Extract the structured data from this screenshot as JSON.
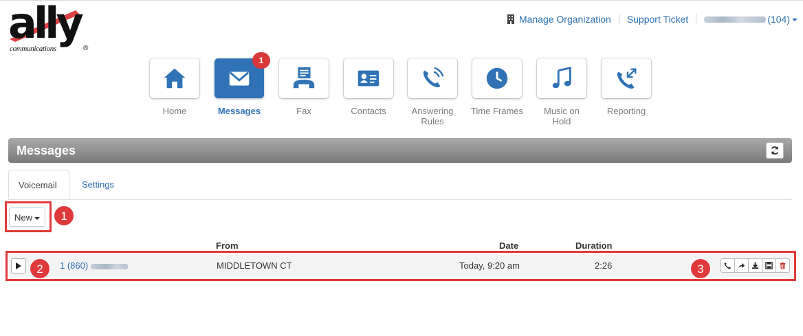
{
  "brand": {
    "logo_word": "ally",
    "logo_sub": "communications",
    "logo_reg": "®",
    "accent": "#e0393b",
    "blue": "#2f73b6"
  },
  "topnav": {
    "manage_org": "Manage Organization",
    "support": "Support Ticket",
    "user_ext": "(104)"
  },
  "apps": [
    {
      "label": "Home",
      "icon": "home-icon"
    },
    {
      "label": "Messages",
      "icon": "envelope-icon",
      "badge": "1",
      "active": true
    },
    {
      "label": "Fax",
      "icon": "fax-icon"
    },
    {
      "label": "Contacts",
      "icon": "contact-card-icon"
    },
    {
      "label": "Answering Rules",
      "icon": "phone-waves-icon"
    },
    {
      "label": "Time Frames",
      "icon": "clock-icon"
    },
    {
      "label": "Music on Hold",
      "icon": "music-note-icon"
    },
    {
      "label": "Reporting",
      "icon": "phone-arrows-icon"
    }
  ],
  "section": {
    "title": "Messages"
  },
  "tabs": {
    "voicemail": "Voicemail",
    "settings": "Settings"
  },
  "filter": {
    "label": "New"
  },
  "callouts": [
    "1",
    "2",
    "3"
  ],
  "table": {
    "headers": {
      "from": "From",
      "date": "Date",
      "duration": "Duration"
    },
    "rows": [
      {
        "phone": "1 (860)",
        "from": "MIDDLETOWN CT",
        "date": "Today, 9:20 am",
        "duration": "2:26"
      }
    ]
  }
}
